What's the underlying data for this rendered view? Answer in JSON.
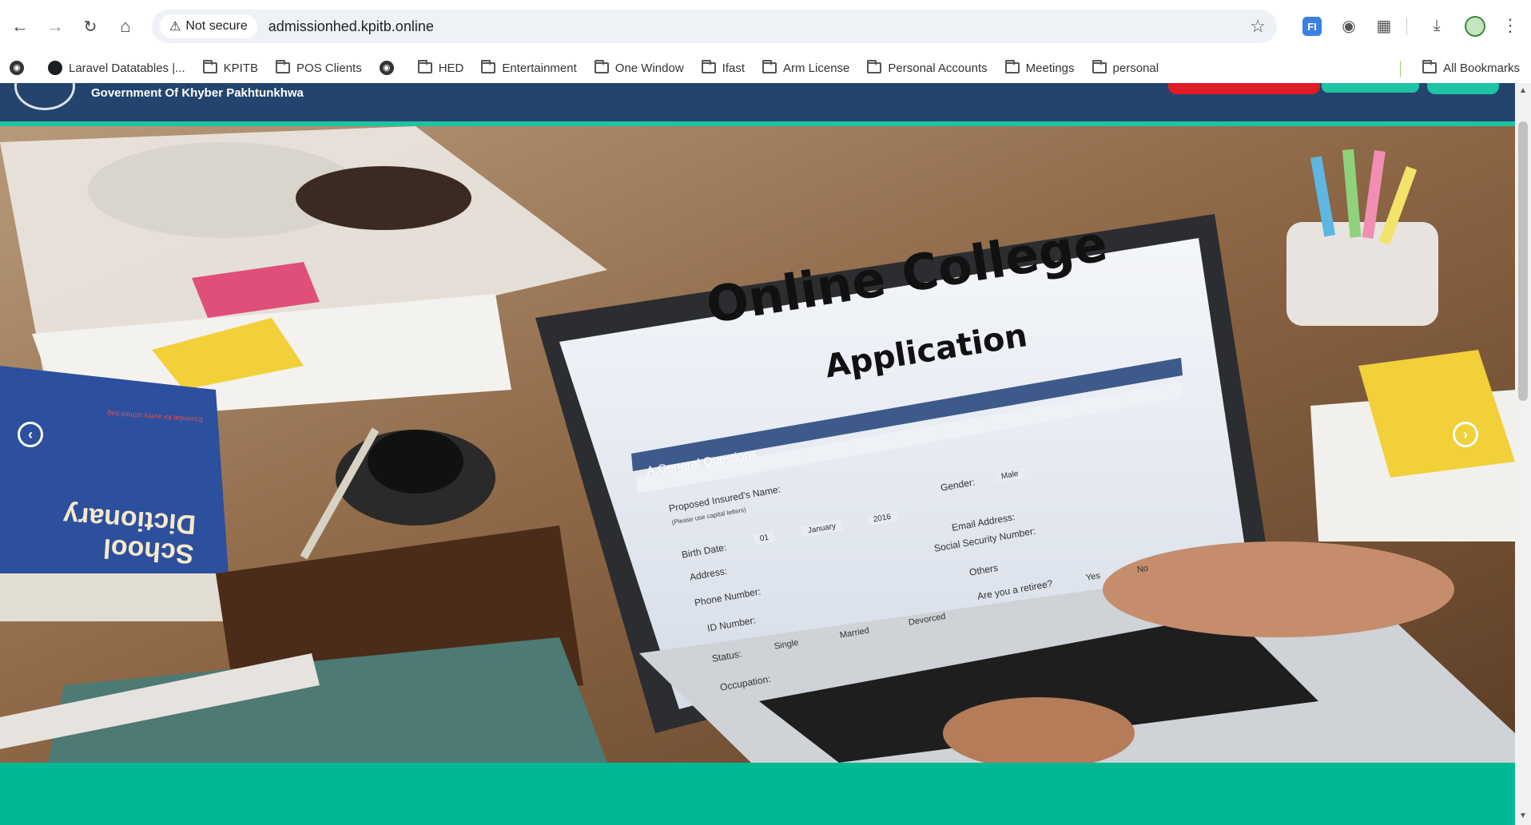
{
  "browser": {
    "security_label": "Not secure",
    "url": "admissionhed.kpitb.online",
    "ext_fi_label": "FI",
    "bookmarks": [
      {
        "label": "Laravel Datatables |...",
        "icon": "github-icon"
      },
      {
        "label": "KPITB",
        "icon": "folder-icon"
      },
      {
        "label": "POS Clients",
        "icon": "folder-icon"
      },
      {
        "label": "",
        "icon": "globe-icon"
      },
      {
        "label": "HED",
        "icon": "folder-icon"
      },
      {
        "label": "Entertainment",
        "icon": "folder-icon"
      },
      {
        "label": "One Window",
        "icon": "folder-icon"
      },
      {
        "label": "Ifast",
        "icon": "folder-icon"
      },
      {
        "label": "Arm License",
        "icon": "folder-icon"
      },
      {
        "label": "Personal Accounts",
        "icon": "folder-icon"
      },
      {
        "label": "Meetings",
        "icon": "folder-icon"
      },
      {
        "label": "personal",
        "icon": "folder-icon"
      }
    ],
    "all_bookmarks": "All Bookmarks"
  },
  "site": {
    "government_label": "Government Of Khyber Pakhtunkhwa",
    "colors": {
      "header": "#24446e",
      "accent": "#1ec3a4",
      "teal": "#00b894",
      "red_button": "#e01b24"
    }
  },
  "slide": {
    "title_line1": "Online College",
    "title_line2": "Application",
    "section": "A.General Questions",
    "fields": {
      "insured_name": "Proposed Insured's Name:",
      "capital_hint": "(Please use capital letters)",
      "gender": "Gender:",
      "gender_value": "Male",
      "birth_date": "Birth Date:",
      "day": "01",
      "month": "January",
      "year": "2016",
      "email": "Email Address:",
      "address": "Address:",
      "ssn": "Social Security Number:",
      "phone": "Phone Number:",
      "id": "ID Number:",
      "others": "Others",
      "retiree": "Are you a retiree?",
      "yes": "Yes",
      "no": "No",
      "status": "Status:",
      "single": "Single",
      "married": "Married",
      "divorced": "Devorced",
      "occupation": "Occupation:"
    },
    "book_title": "School Dictionary",
    "book_sub": "Essential for every school bag"
  }
}
